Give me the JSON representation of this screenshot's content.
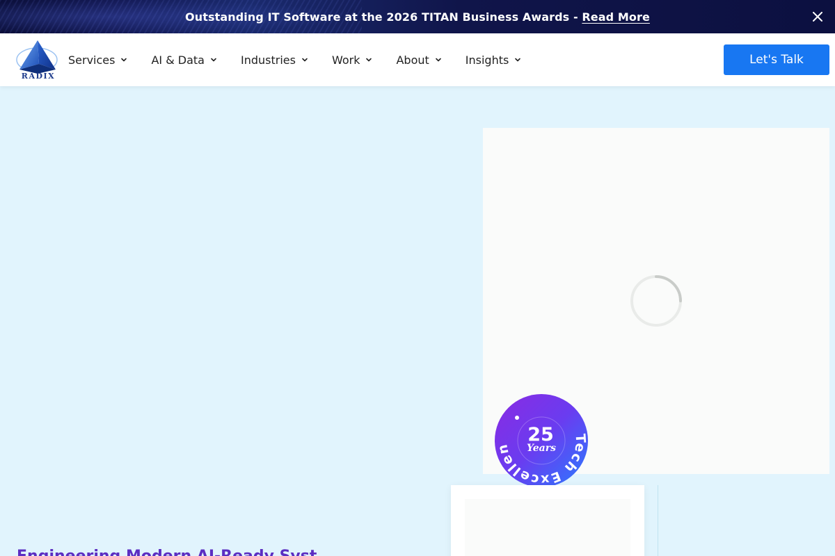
{
  "announcement": {
    "text": "Outstanding IT Software at the 2026 TITAN Business Awards - ",
    "link_label": "Read More",
    "close_icon": "close-icon"
  },
  "header": {
    "logo_text": "RADIX",
    "nav": [
      {
        "label": "Services"
      },
      {
        "label": "AI & Data"
      },
      {
        "label": "Industries"
      },
      {
        "label": "Work"
      },
      {
        "label": "About"
      },
      {
        "label": "Insights"
      }
    ],
    "cta_label": "Let's Talk"
  },
  "hero": {
    "headline_partial": "Engineering Modern AI-Ready Syst",
    "badge": {
      "number": "25",
      "word": "Years",
      "ring_text": "Tech Excellence & Trust"
    }
  },
  "colors": {
    "accent": "#1877f2",
    "page_bg": "#e1f4fd",
    "announce_bg": "#0c1040",
    "badge_gradient_start": "#7b2ff2",
    "badge_gradient_end": "#2a7bff",
    "headline": "#5b2ec2"
  }
}
